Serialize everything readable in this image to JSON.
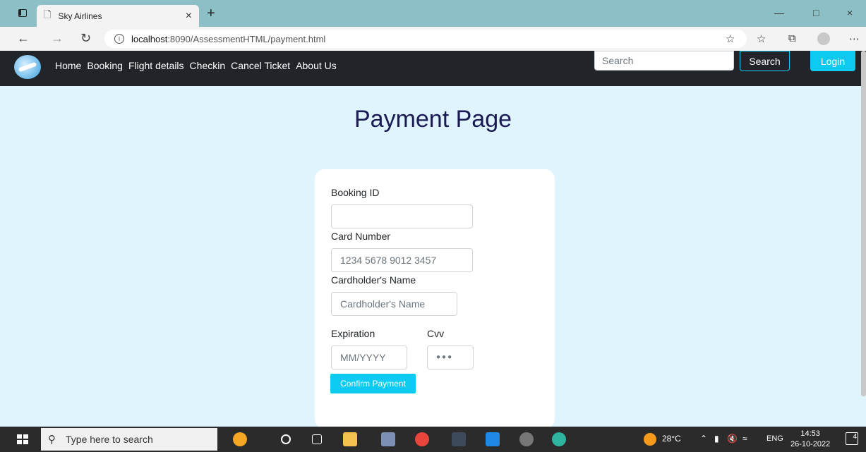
{
  "browser": {
    "tab_title": "Sky Airlines",
    "url_host": "localhost",
    "url_rest": ":8090/AssessmentHTML/payment.html"
  },
  "navbar": {
    "links": [
      "Home",
      "Booking",
      "Flight details",
      "Checkin",
      "Cancel Ticket",
      "About Us"
    ],
    "search_placeholder": "Search",
    "search_button": "Search",
    "login_button": "Login"
  },
  "main": {
    "title": "Payment Page",
    "form": {
      "booking_id_label": "Booking ID",
      "booking_id_value": "",
      "card_number_label": "Card Number",
      "card_number_placeholder": "1234 5678 9012 3457",
      "cardholder_label": "Cardholder's Name",
      "cardholder_placeholder": "Cardholder's Name",
      "expiration_label": "Expiration",
      "expiration_placeholder": "MM/YYYY",
      "cvv_label": "Cvv",
      "cvv_placeholder": "●●●",
      "confirm_button": "Confirm Payment"
    }
  },
  "taskbar": {
    "search_placeholder": "Type here to search",
    "temperature": "28°C",
    "language": "ENG",
    "time": "14:53",
    "date": "26-10-2022",
    "notification_count": "4"
  }
}
